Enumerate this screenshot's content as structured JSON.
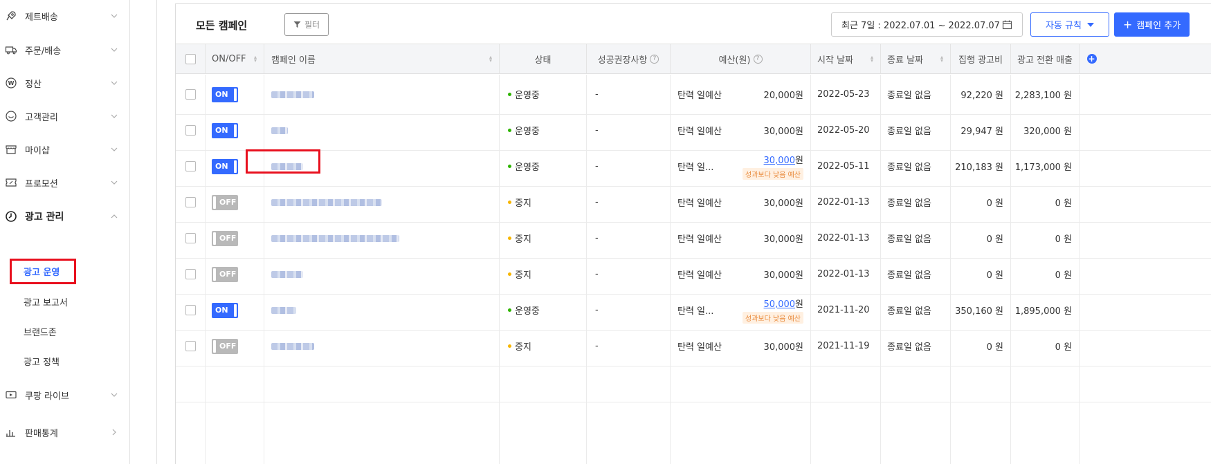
{
  "sidebar": {
    "items": [
      {
        "label": "제트배송",
        "icon": "rocket-icon"
      },
      {
        "label": "주문/배송",
        "icon": "truck-icon"
      },
      {
        "label": "정산",
        "icon": "won-icon"
      },
      {
        "label": "고객관리",
        "icon": "smile-icon"
      },
      {
        "label": "마이샵",
        "icon": "shop-icon"
      },
      {
        "label": "프로모션",
        "icon": "ticket-icon"
      },
      {
        "label": "광고 관리",
        "icon": "clock-icon"
      },
      {
        "label": "쿠팡 라이브",
        "icon": "live-icon"
      },
      {
        "label": "판매통계",
        "icon": "bar-chart-icon"
      }
    ],
    "ad_sub": [
      "광고 운영",
      "광고 보고서",
      "브랜드존",
      "광고 정책"
    ]
  },
  "toolbar": {
    "title": "모든 캠페인",
    "filter_label": "필터",
    "date_range": "최근 7일 : 2022.07.01 ~ 2022.07.07",
    "rule_label": "자동 규칙",
    "add_label": "캠페인 추가"
  },
  "table": {
    "headers": [
      "ON/OFF",
      "캠페인 이름",
      "상태",
      "성공권장사항",
      "예산(원)",
      "시작 날짜",
      "종료 날짜",
      "집행 광고비",
      "광고 전환 매출"
    ],
    "rows": [
      {
        "toggle": "ON",
        "status": "운영중",
        "recommend": "-",
        "budget_type": "탄력 일예산",
        "budget": "20,000원",
        "start": "2022-05-23",
        "end": "종료일 없음",
        "spend": "92,220 원",
        "revenue": "2,283,100 원"
      },
      {
        "toggle": "ON",
        "status": "운영중",
        "recommend": "-",
        "budget_type": "탄력 일예산",
        "budget": "30,000원",
        "start": "2022-05-20",
        "end": "종료일 없음",
        "spend": "29,947 원",
        "revenue": "320,000 원"
      },
      {
        "toggle": "ON",
        "status": "운영중",
        "recommend": "-",
        "budget_type": "탄력 일...",
        "budget_link": "30,000",
        "budget_unit": "원",
        "warning": "성과보다 낮음 예산",
        "start": "2022-05-11",
        "end": "종료일 없음",
        "spend": "210,183 원",
        "revenue": "1,173,000 원"
      },
      {
        "toggle": "OFF",
        "status": "중지",
        "recommend": "-",
        "budget_type": "탄력 일예산",
        "budget": "30,000원",
        "start": "2022-01-13",
        "end": "종료일 없음",
        "spend": "0 원",
        "revenue": "0 원"
      },
      {
        "toggle": "OFF",
        "status": "중지",
        "recommend": "-",
        "budget_type": "탄력 일예산",
        "budget": "30,000원",
        "start": "2022-01-13",
        "end": "종료일 없음",
        "spend": "0 원",
        "revenue": "0 원"
      },
      {
        "toggle": "OFF",
        "status": "중지",
        "recommend": "-",
        "budget_type": "탄력 일예산",
        "budget": "30,000원",
        "start": "2022-01-13",
        "end": "종료일 없음",
        "spend": "0 원",
        "revenue": "0 원"
      },
      {
        "toggle": "ON",
        "status": "운영중",
        "recommend": "-",
        "budget_type": "탄력 일...",
        "budget_link": "50,000",
        "budget_unit": "원",
        "warning": "성과보다 낮음 예산",
        "start": "2021-11-20",
        "end": "종료일 없음",
        "spend": "350,160 원",
        "revenue": "1,895,000 원"
      },
      {
        "toggle": "OFF",
        "status": "중지",
        "recommend": "-",
        "budget_type": "탄력 일예산",
        "budget": "30,000원",
        "start": "2021-11-19",
        "end": "종료일 없음",
        "spend": "0 원",
        "revenue": "0 원"
      }
    ]
  },
  "colors": {
    "accent": "#346aff",
    "running": "#2db400",
    "stopped": "#f7b500",
    "highlight": "#e8101e"
  }
}
